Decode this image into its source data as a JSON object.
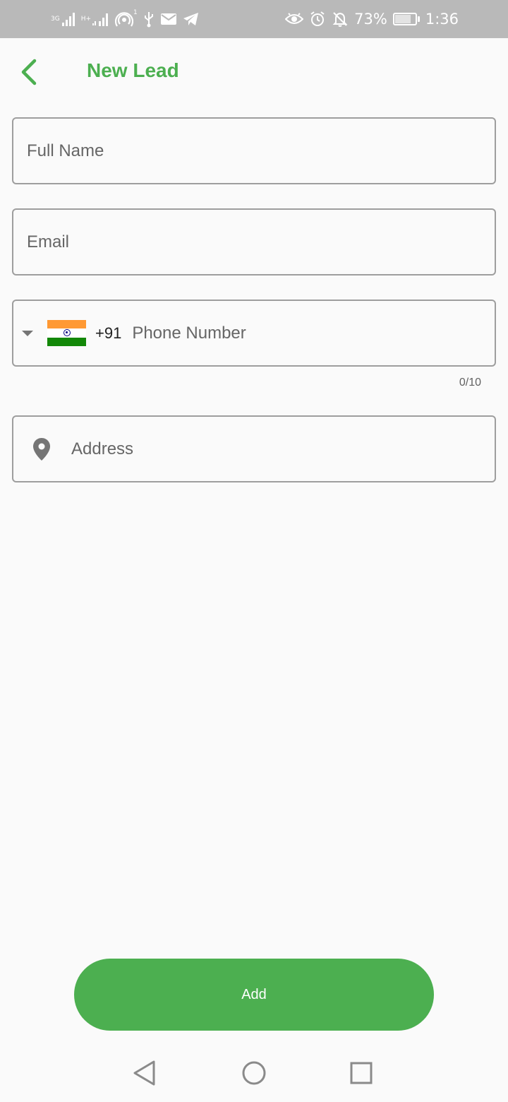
{
  "status_bar": {
    "net_type": "3G",
    "net_type_2": "H+",
    "hotspot_badge": "1",
    "battery_percent": "73%",
    "battery_level": 0.73,
    "time": "1:36"
  },
  "header": {
    "title": "New Lead"
  },
  "form": {
    "full_name_placeholder": "Full Name",
    "email_placeholder": "Email",
    "phone": {
      "dial_code": "+91",
      "placeholder": "Phone Number",
      "counter": "0/10"
    },
    "address_placeholder": "Address"
  },
  "actions": {
    "add_label": "Add"
  },
  "colors": {
    "accent": "#4caf50",
    "status_bar_bg": "#b9b9b9"
  },
  "icons": [
    "back-arrow-icon",
    "dropdown-arrow-icon",
    "india-flag-icon",
    "location-pin-icon",
    "nav-back-icon",
    "nav-home-icon",
    "nav-recents-icon"
  ]
}
